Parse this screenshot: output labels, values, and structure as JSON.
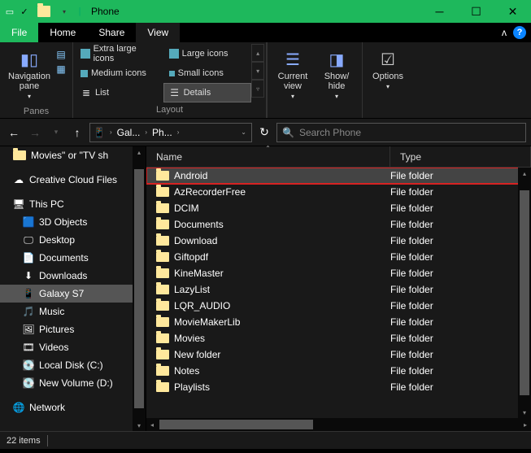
{
  "titlebar": {
    "title": "Phone"
  },
  "tabs": {
    "file": "File",
    "home": "Home",
    "share": "Share",
    "view": "View"
  },
  "ribbon": {
    "panes": {
      "nav_pane": "Navigation\npane",
      "label": "Panes"
    },
    "layout": {
      "opts": {
        "xl": "Extra large icons",
        "lg": "Large icons",
        "md": "Medium icons",
        "sm": "Small icons",
        "list": "List",
        "details": "Details"
      },
      "label": "Layout"
    },
    "current_view": "Current\nview",
    "show_hide": "Show/\nhide",
    "options": "Options"
  },
  "address": {
    "seg1": "Gal...",
    "seg2": "Ph...",
    "drive_icon": "▭"
  },
  "search": {
    "placeholder": "Search Phone"
  },
  "sidebar": {
    "pinned": {
      "label": "Movies\" or \"TV sh"
    },
    "items": [
      {
        "label": "Creative Cloud Files",
        "icon": "cc",
        "indent": false
      },
      {
        "label": "This PC",
        "icon": "pc",
        "indent": false
      },
      {
        "label": "3D Objects",
        "icon": "3d",
        "indent": true
      },
      {
        "label": "Desktop",
        "icon": "desk",
        "indent": true
      },
      {
        "label": "Documents",
        "icon": "doc",
        "indent": true
      },
      {
        "label": "Downloads",
        "icon": "dl",
        "indent": true
      },
      {
        "label": "Galaxy S7",
        "icon": "phone",
        "indent": true,
        "selected": true
      },
      {
        "label": "Music",
        "icon": "music",
        "indent": true
      },
      {
        "label": "Pictures",
        "icon": "pic",
        "indent": true
      },
      {
        "label": "Videos",
        "icon": "vid",
        "indent": true
      },
      {
        "label": "Local Disk (C:)",
        "icon": "disk",
        "indent": true
      },
      {
        "label": "New Volume (D:)",
        "icon": "disk",
        "indent": true
      },
      {
        "label": "Network",
        "icon": "net",
        "indent": false
      }
    ]
  },
  "file_header": {
    "name": "Name",
    "type": "Type"
  },
  "files": [
    {
      "name": "Android",
      "type": "File folder",
      "highlight": true
    },
    {
      "name": "AzRecorderFree",
      "type": "File folder"
    },
    {
      "name": "DCIM",
      "type": "File folder"
    },
    {
      "name": "Documents",
      "type": "File folder"
    },
    {
      "name": "Download",
      "type": "File folder"
    },
    {
      "name": "Giftopdf",
      "type": "File folder"
    },
    {
      "name": "KineMaster",
      "type": "File folder"
    },
    {
      "name": "LazyList",
      "type": "File folder"
    },
    {
      "name": "LQR_AUDIO",
      "type": "File folder"
    },
    {
      "name": "MovieMakerLib",
      "type": "File folder"
    },
    {
      "name": "Movies",
      "type": "File folder"
    },
    {
      "name": "New folder",
      "type": "File folder"
    },
    {
      "name": "Notes",
      "type": "File folder"
    },
    {
      "name": "Playlists",
      "type": "File folder"
    }
  ],
  "status": {
    "count": "22 items"
  }
}
